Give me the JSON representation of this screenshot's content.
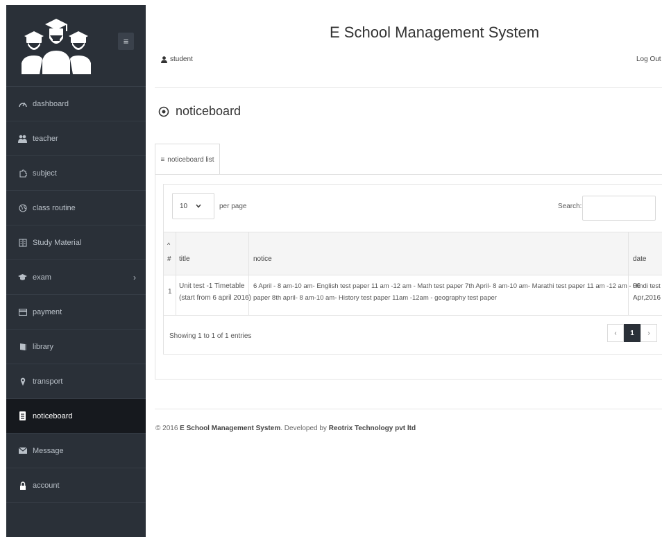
{
  "app": {
    "title": "E School Management System",
    "user": "student",
    "logout": "Log Out {"
  },
  "sidebar": {
    "toggle_icon": "hamburger-icon",
    "items": [
      {
        "label": "dashboard",
        "icon": "dashboard-icon"
      },
      {
        "label": "teacher",
        "icon": "users-icon"
      },
      {
        "label": "subject",
        "icon": "puzzle-icon"
      },
      {
        "label": "class routine",
        "icon": "globe-icon"
      },
      {
        "label": "Study Material",
        "icon": "book-icon"
      },
      {
        "label": "exam",
        "icon": "graduation-cap-icon",
        "has_submenu": true
      },
      {
        "label": "payment",
        "icon": "credit-card-icon"
      },
      {
        "label": "library",
        "icon": "library-icon"
      },
      {
        "label": "transport",
        "icon": "map-pin-icon"
      },
      {
        "label": "noticeboard",
        "icon": "clipboard-icon",
        "active": true
      },
      {
        "label": "Message",
        "icon": "envelope-icon"
      },
      {
        "label": "account",
        "icon": "lock-icon"
      }
    ],
    "colors": {
      "bg": "#2a3038",
      "active_bg": "#16191e"
    }
  },
  "page": {
    "title": "noticeboard",
    "tab_label": "noticeboard list"
  },
  "table_controls": {
    "per_page_value": "10",
    "per_page_label": "per page",
    "search_label": "Search:",
    "search_value": ""
  },
  "table": {
    "sort_indicator": "^",
    "columns": [
      "#",
      "title",
      "notice",
      "date"
    ],
    "rows": [
      {
        "num": "1",
        "title_line1": "Unit test -1 Timetable",
        "title_line2": "(start from 6 april 2016)",
        "notice_line1": "6 April - 8 am-10 am- English test paper 11 am -12 am - Math test paper 7th April- 8 am-10 am- Marathi test paper 11 am -12 am - Hindi test",
        "notice_line2": "paper 8th april- 8 am-10 am- History test paper 11am -12am - geography test paper",
        "date_line1": "06",
        "date_line2": "Apr,2016"
      }
    ],
    "showing": "Showing 1 to 1 of 1 entries",
    "pagination": {
      "prev": "‹",
      "current": "1",
      "next": "›"
    }
  },
  "footer": {
    "prefix": "© 2016 ",
    "brand": "E School Management System",
    "middle": ". Developed by ",
    "company": "Reotrix Technology pvt ltd"
  }
}
